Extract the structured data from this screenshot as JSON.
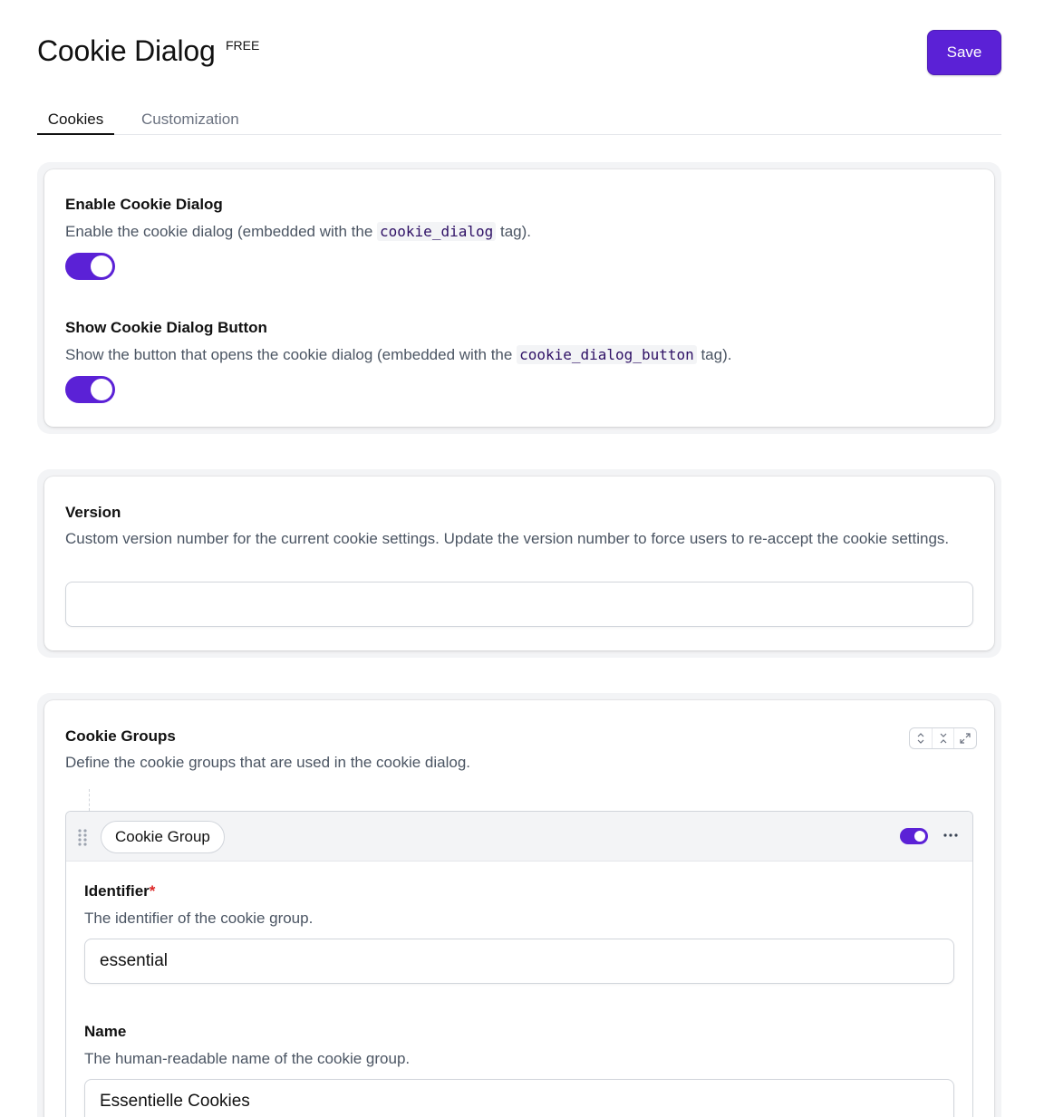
{
  "header": {
    "title": "Cookie Dialog",
    "badge": "FREE",
    "save_label": "Save"
  },
  "tabs": [
    {
      "label": "Cookies",
      "active": true
    },
    {
      "label": "Customization",
      "active": false
    }
  ],
  "enable_dialog": {
    "label": "Enable Cookie Dialog",
    "desc_before": "Enable the cookie dialog (embedded with the ",
    "code": "cookie_dialog",
    "desc_after": " tag).",
    "enabled": true
  },
  "show_button": {
    "label": "Show Cookie Dialog Button",
    "desc_before": "Show the button that opens the cookie dialog (embedded with the ",
    "code": "cookie_dialog_button",
    "desc_after": " tag).",
    "enabled": true
  },
  "version": {
    "label": "Version",
    "description": "Custom version number for the current cookie settings. Update the version number to force users to re-accept the cookie settings.",
    "value": ""
  },
  "cookie_groups": {
    "label": "Cookie Groups",
    "description": "Define the cookie groups that are used in the cookie dialog.",
    "toolbar_icons": [
      "collapse-all-icon",
      "collapse-icon",
      "expand-icon"
    ],
    "group": {
      "chip_label": "Cookie Group",
      "enabled": true,
      "identifier": {
        "label": "Identifier",
        "required_mark": "*",
        "description": "The identifier of the cookie group.",
        "value": "essential"
      },
      "name": {
        "label": "Name",
        "description": "The human-readable name of the cookie group.",
        "value": "Essentielle Cookies"
      }
    }
  },
  "colors": {
    "accent": "#5b21d6",
    "required": "#dc2626"
  }
}
